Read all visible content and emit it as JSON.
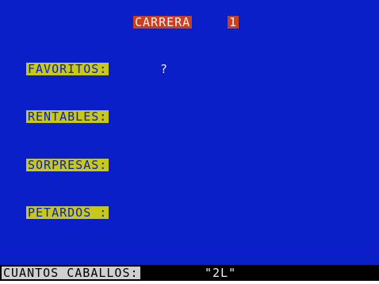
{
  "header": {
    "race_label": "CARRERA",
    "race_number": "1"
  },
  "categories": {
    "favoritos": {
      "label": "FAVORITOS:",
      "value": "?"
    },
    "rentables": {
      "label": "RENTABLES:"
    },
    "sorpresas": {
      "label": "SORPRESAS:"
    },
    "petardos": {
      "label": "PETARDOS :"
    }
  },
  "prompt": {
    "label": "CUANTOS CABALLOS:",
    "value": "\"2L\""
  },
  "colors": {
    "background": "#0a1fc8",
    "title_bg": "#c9401f",
    "label_bg": "#c8c819",
    "status_bg": "#000000"
  }
}
